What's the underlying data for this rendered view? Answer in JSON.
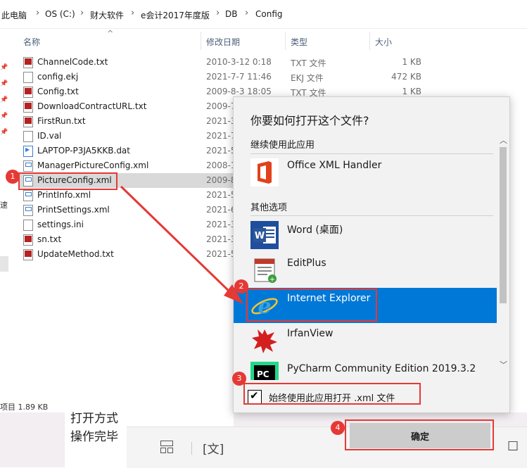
{
  "breadcrumb": [
    "此电脑",
    "OS (C:)",
    "财大软件",
    "e会计2017年度版",
    "DB",
    "Config"
  ],
  "columns": {
    "name": "名称",
    "date": "修改日期",
    "type": "类型",
    "size": "大小"
  },
  "files": [
    {
      "name": "ChannelCode.txt",
      "date": "2010-3-12 0:18",
      "type": "TXT 文件",
      "size": "1 KB",
      "icon": "txt-file-icon"
    },
    {
      "name": "config.ekj",
      "date": "2021-7-7 11:46",
      "type": "EKJ 文件",
      "size": "472 KB",
      "icon": "blank-file-icon"
    },
    {
      "name": "Config.txt",
      "date": "2009-8-3 18:05",
      "type": "TXT 文件",
      "size": "1 KB",
      "icon": "txt-file-icon"
    },
    {
      "name": "DownloadContractURL.txt",
      "date": "2009-7",
      "type": "",
      "size": "",
      "icon": "txt-file-icon"
    },
    {
      "name": "FirstRun.txt",
      "date": "2021-3",
      "type": "",
      "size": "",
      "icon": "txt-file-icon"
    },
    {
      "name": "ID.val",
      "date": "2021-7",
      "type": "",
      "size": "",
      "icon": "blank-file-icon"
    },
    {
      "name": "LAPTOP-P3JA5KKB.dat",
      "date": "2021-5",
      "type": "",
      "size": "",
      "icon": "dat-file-icon"
    },
    {
      "name": "ManagerPictureConfig.xml",
      "date": "2008-1",
      "type": "",
      "size": "",
      "icon": "xml-file-icon"
    },
    {
      "name": "PictureConfig.xml",
      "date": "2009-8",
      "type": "",
      "size": "",
      "icon": "xml-file-icon"
    },
    {
      "name": "PrintInfo.xml",
      "date": "2021-5",
      "type": "",
      "size": "",
      "icon": "xml-file-icon"
    },
    {
      "name": "PrintSettings.xml",
      "date": "2021-6",
      "type": "",
      "size": "",
      "icon": "xml-file-icon"
    },
    {
      "name": "settings.ini",
      "date": "2021-3",
      "type": "",
      "size": "",
      "icon": "blank-file-icon"
    },
    {
      "name": "sn.txt",
      "date": "2021-3",
      "type": "",
      "size": "",
      "icon": "txt-file-icon"
    },
    {
      "name": "UpdateMethod.txt",
      "date": "2021-5",
      "type": "",
      "size": "",
      "icon": "txt-file-icon"
    }
  ],
  "left_fragment": "速",
  "status": "项目 1.89 KB",
  "doc": {
    "line1": "打开方式",
    "line2": "操作完毕"
  },
  "dialog": {
    "title": "你要如何打开这个文件?",
    "section_continue": "继续使用此应用",
    "section_other": "其他选项",
    "apps": [
      {
        "name": "Office XML Handler",
        "icon": "office-icon"
      },
      {
        "name": "Word (桌面)",
        "icon": "word-icon"
      },
      {
        "name": "EditPlus",
        "icon": "editplus-icon"
      },
      {
        "name": "Internet Explorer",
        "icon": "internet-explorer-icon",
        "selected": true
      },
      {
        "name": "IrfanView",
        "icon": "irfanview-icon"
      },
      {
        "name": "PyCharm Community Edition 2019.3.2",
        "icon": "pycharm-icon"
      }
    ],
    "always_label": "始终使用此应用打开 .xml 文件",
    "always_checked": true,
    "ok_label": "确定"
  },
  "badges": [
    "1",
    "2",
    "3",
    "4"
  ],
  "colors": {
    "accent": "#0078d7",
    "annotation": "#e53935",
    "selection": "#d9d9d9"
  }
}
